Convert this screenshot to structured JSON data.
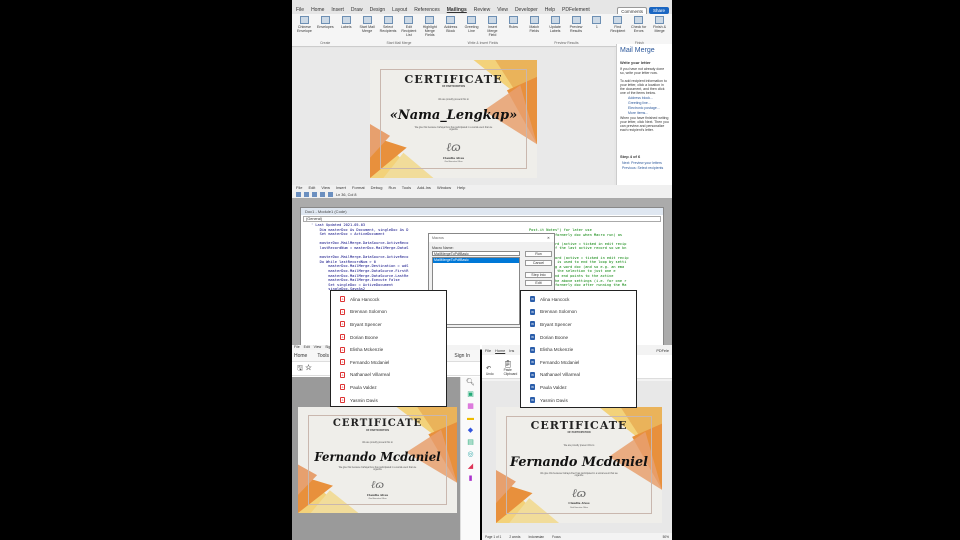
{
  "word": {
    "tabs": [
      "File",
      "Home",
      "Insert",
      "Draw",
      "Design",
      "Layout",
      "References",
      "Mailings",
      "Review",
      "View",
      "Developer",
      "Help",
      "PDFelement"
    ],
    "active_tab": "Mailings",
    "comments_label": "Comments",
    "share_label": "Share",
    "ribbon_buttons": [
      "Chinese Envelope",
      "Envelopes",
      "Labels",
      "Start Mail Merge",
      "Select Recipients",
      "Edit Recipient List",
      "Highlight Merge Fields",
      "Address Block",
      "Greeting Line",
      "Insert Merge Field",
      "Rules",
      "Match Fields",
      "Update Labels",
      "Preview Results",
      "1",
      "Find Recipient",
      "Check for Errors",
      "Finish & Merge"
    ],
    "groups": [
      "Create",
      "Start Mail Merge",
      "Write & Insert Fields",
      "Preview Results",
      "Finish"
    ],
    "pane": {
      "title": "Mail Merge",
      "heading": "Write your letter",
      "p1": "If you have not already done so, write your letter now.",
      "p2": "To add recipient information to your letter, click a location in the document, and then click one of the items below.",
      "links": [
        "Address block...",
        "Greeting line...",
        "Electronic postage...",
        "More items..."
      ],
      "p3": "When you have finished writing your letter, click Next. Then you can preview and personalize each recipient's letter.",
      "step": "Step 4 of 6",
      "next": "Next: Preview your letters",
      "prev": "Previous: Select recipients"
    }
  },
  "certificate": {
    "title": "CERTIFICATE",
    "subtitle": "OF PARTICIPATION",
    "present": "We are proudly present this to",
    "merge_field": "«Nama_Lengkap»",
    "name": "Fernando Mcdaniel",
    "body": "We give this because Cahaya Devi has participated in a social event that we organize",
    "signer": "Claudia Alves",
    "signer_role": "Chief Executive Officer"
  },
  "vba": {
    "menu": [
      "File",
      "Edit",
      "View",
      "Insert",
      "Format",
      "Debug",
      "Run",
      "Tools",
      "Add-Ins",
      "Window",
      "Help"
    ],
    "position": "Ln 36, Col 8",
    "window_title": "Doc1 - Module1 (Code)",
    "object_combo": "(General)",
    "code": "' Last Updated 2021-05-03\n    Dim masterDoc As Document, singleDoc As D\n    Set masterDoc = ActiveDocument\n\n    masterDoc.MailMerge.DataSource.ActiveReco\n    lastRecordNum = masterDoc.MailMerge.DataS\n\n    masterDoc.MailMerge.DataSource.ActiveReco\n    Do While lastRecordNum > 0\n        masterDoc.MailMerge.Destination = wdS\n        masterDoc.MailMerge.DataSource.FirstR\n        masterDoc.MailMerge.DataSource.LastRe\n        masterDoc.MailMerge.Execute False\n        Set singleDoc = ActiveDocument\n        singleDoc.SaveAs2",
    "comments": "Post-it Notes\") for later use\nveDocument (formerly doc when Macro run) as \n\n active record (active = ticked in edit recip\nord number of the last active record so we kn\n\nt active record (active = ticked in edit recip\nastRecordNum is used to end the loop by setti\n are creating a word doc (and so e.g. an ema\n     ' limit the selection to just one e\n     ' ... and end points to the active\ne based on the above settings (i.e. for one r\nveDocument (formerly doc after running the Ma",
    "code_lower": "(\"PdfFileName\").Value & \".pdf\"\n\n      LastRecordNum Then\n\n\n      wdNextRecord",
    "combo2": "nt (Dec)",
    "macro_dialog": {
      "title": "Macros",
      "label": "Macro Name:",
      "value": "MailMergeToPdfBasic",
      "items": [
        "MailMergeToPdfBasic"
      ],
      "buttons": [
        "Run",
        "Cancel",
        "Step Into",
        "Edit",
        "Create",
        "Delete"
      ]
    }
  },
  "pdf_list": [
    "Alina Hancock",
    "Brennan Solomon",
    "Bryant Spencer",
    "Dorian Boone",
    "Elisha Mckenzie",
    "Fernando Mcdaniel",
    "Nathanael Villarreal",
    "Paula Valdez",
    "Yasmin Davis"
  ],
  "word_list": [
    "Alina Hancock",
    "Brennan Solomon",
    "Bryant Spencer",
    "Dorian Boone",
    "Elisha Mckenzie",
    "Fernando Mcdaniel",
    "Nathanael Villarreal",
    "Paula Valdez",
    "Yasmin Davis"
  ],
  "acrobat": {
    "menu": [
      "File",
      "Edit",
      "View",
      "Sign"
    ],
    "tabs": [
      "Home",
      "Tools"
    ],
    "sign_in": "Sign In"
  },
  "word2": {
    "tabs": [
      "File",
      "Home",
      "Ins"
    ],
    "undo": "Undo",
    "clipboard": "Clipboard",
    "paste": "Paste",
    "pdfele": "PDFele",
    "status": [
      "Page 1 of 1",
      "2 words",
      "Indonesian",
      "Focus",
      "50%"
    ]
  },
  "colors": {
    "accent": "#1a66c2",
    "cert_orange": "#e8903c",
    "cert_yellow": "#f3d27a",
    "cert_bg": "#efeeea"
  }
}
